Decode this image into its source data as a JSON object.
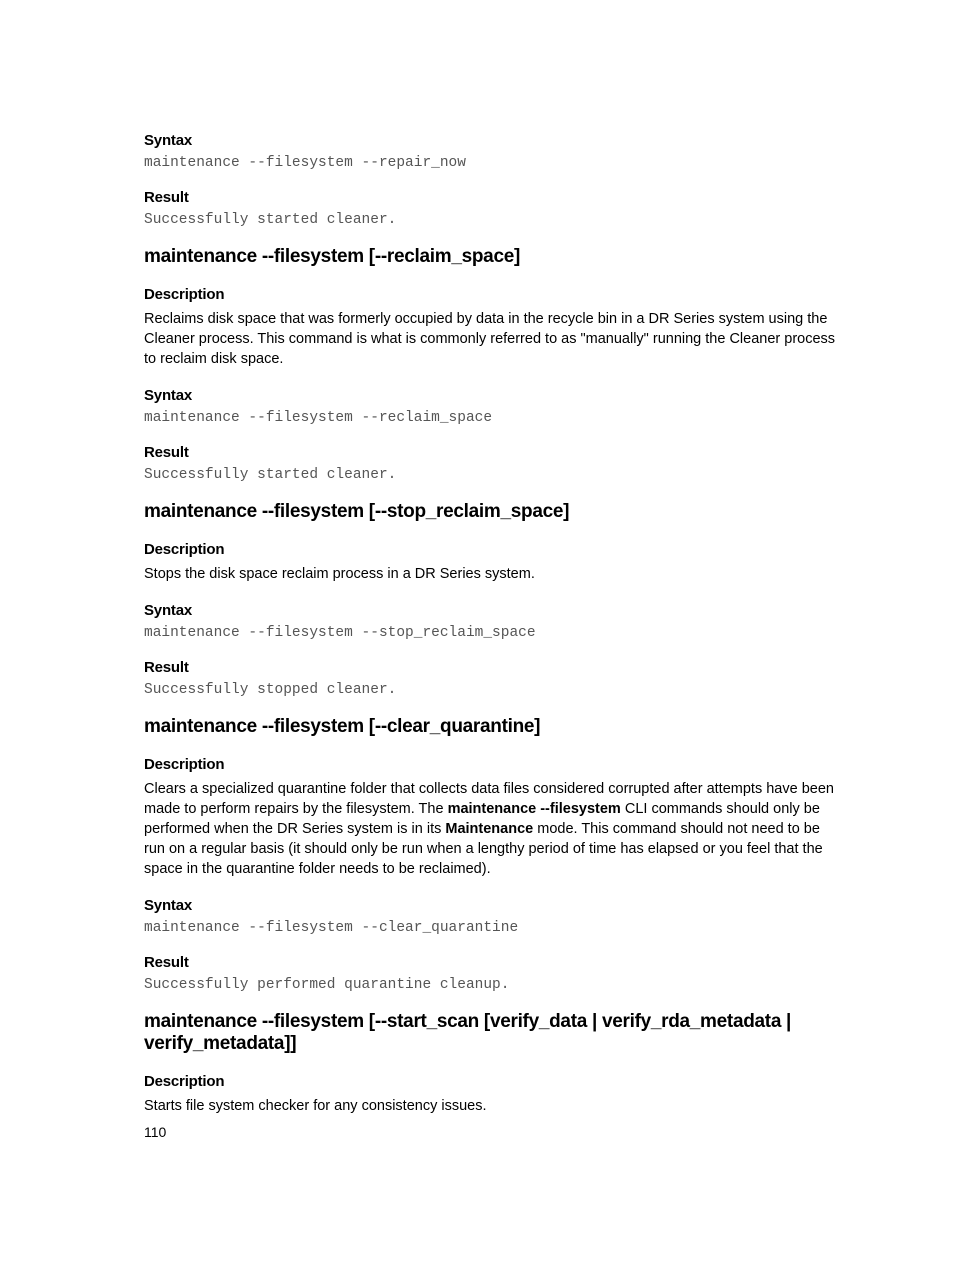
{
  "sections": [
    {
      "syntax_label": "Syntax",
      "syntax_code": "maintenance --filesystem --repair_now",
      "result_label": "Result",
      "result_code": "Successfully started cleaner."
    },
    {
      "title": "maintenance --filesystem [--reclaim_space]",
      "desc_label": "Description",
      "desc_text": "Reclaims disk space that was formerly occupied by data in the recycle bin in a DR Series system using the Cleaner process. This command is what is commonly referred to as \"manually\" running the Cleaner process to reclaim disk space.",
      "syntax_label": "Syntax",
      "syntax_code": "maintenance --filesystem --reclaim_space",
      "result_label": "Result",
      "result_code": "Successfully started cleaner."
    },
    {
      "title": "maintenance --filesystem [--stop_reclaim_space]",
      "desc_label": "Description",
      "desc_text": "Stops the disk space reclaim process in a DR Series system.",
      "syntax_label": "Syntax",
      "syntax_code": "maintenance --filesystem --stop_reclaim_space",
      "result_label": "Result",
      "result_code": "Successfully stopped cleaner."
    },
    {
      "title": "maintenance --filesystem [--clear_quarantine]",
      "desc_label": "Description",
      "desc_pre": "Clears a specialized quarantine folder that collects data files considered corrupted after attempts have been made to perform repairs by the filesystem. The ",
      "desc_bold1": "maintenance --filesystem",
      "desc_mid": " CLI commands should only be performed when the DR Series system is in its ",
      "desc_bold2": "Maintenance",
      "desc_post": " mode. This command should not need to be run on a regular basis (it should only be run when a lengthy period of time has elapsed or you feel that the space in the quarantine folder needs to be reclaimed).",
      "syntax_label": "Syntax",
      "syntax_code": "maintenance --filesystem --clear_quarantine",
      "result_label": "Result",
      "result_code": "Successfully performed quarantine cleanup."
    },
    {
      "title": "maintenance --filesystem [--start_scan [verify_data | verify_rda_metadata | verify_metadata]]",
      "desc_label": "Description",
      "desc_text": "Starts file system checker for any consistency issues."
    }
  ],
  "page_number": "110"
}
